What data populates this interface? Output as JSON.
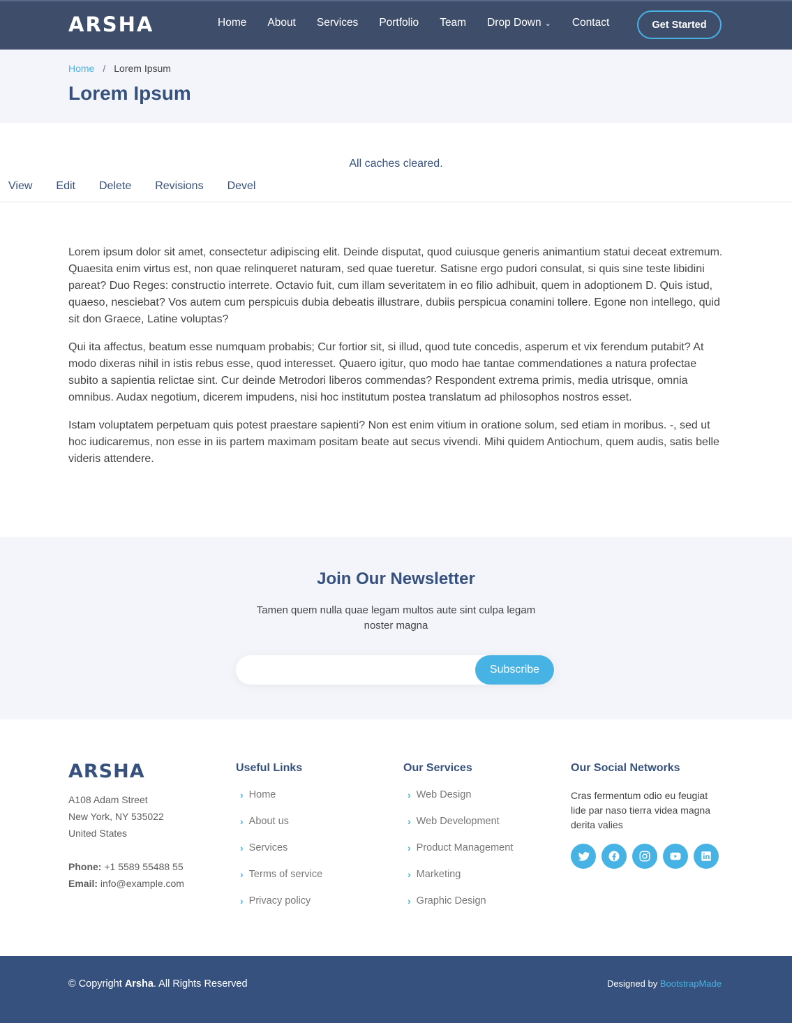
{
  "header": {
    "logo": "ARSHA",
    "nav": [
      "Home",
      "About",
      "Services",
      "Portfolio",
      "Team",
      "Drop Down",
      "Contact"
    ],
    "cta": "Get Started"
  },
  "breadcrumbs": {
    "home": "Home",
    "separator": "/",
    "current": "Lorem Ipsum",
    "title": "Lorem Ipsum"
  },
  "status_message": "All caches cleared.",
  "tabs": [
    "View",
    "Edit",
    "Delete",
    "Revisions",
    "Devel"
  ],
  "content": {
    "paragraphs": [
      "Lorem ipsum dolor sit amet, consectetur adipiscing elit. Deinde disputat, quod cuiusque generis animantium statui deceat extremum. Quaesita enim virtus est, non quae relinqueret naturam, sed quae tueretur. Satisne ergo pudori consulat, si quis sine teste libidini pareat? Duo Reges: constructio interrete. Octavio fuit, cum illam severitatem in eo filio adhibuit, quem in adoptionem D. Quis istud, quaeso, nesciebat? Vos autem cum perspicuis dubia debeatis illustrare, dubiis perspicua conamini tollere. Egone non intellego, quid sit don Graece, Latine voluptas?",
      "Qui ita affectus, beatum esse numquam probabis; Cur fortior sit, si illud, quod tute concedis, asperum et vix ferendum putabit? At modo dixeras nihil in istis rebus esse, quod interesset. Quaero igitur, quo modo hae tantae commendationes a natura profectae subito a sapientia relictae sint. Cur deinde Metrodori liberos commendas? Respondent extrema primis, media utrisque, omnia omnibus. Audax negotium, dicerem impudens, nisi hoc institutum postea translatum ad philosophos nostros esset.",
      "Istam voluptatem perpetuam quis potest praestare sapienti? Non est enim vitium in oratione solum, sed etiam in moribus. -, sed ut hoc iudicaremus, non esse in iis partem maximam positam beate aut secus vivendi. Mihi quidem Antiochum, quem audis, satis belle videris attendere."
    ]
  },
  "newsletter": {
    "title": "Join Our Newsletter",
    "text": "Tamen quem nulla quae legam multos aute sint culpa legam noster magna",
    "input_value": "",
    "button": "Subscribe"
  },
  "footer": {
    "logo": "ARSHA",
    "address": [
      "A108 Adam Street",
      "New York, NY 535022",
      "United States"
    ],
    "phone_label": "Phone:",
    "phone": "+1 5589 55488 55",
    "email_label": "Email:",
    "email": "info@example.com",
    "useful_links_title": "Useful Links",
    "useful_links": [
      "Home",
      "About us",
      "Services",
      "Terms of service",
      "Privacy policy"
    ],
    "services_title": "Our Services",
    "services": [
      "Web Design",
      "Web Development",
      "Product Management",
      "Marketing",
      "Graphic Design"
    ],
    "social_title": "Our Social Networks",
    "social_text": "Cras fermentum odio eu feugiat lide par naso tierra videa magna derita valies",
    "social_icons": [
      "twitter-icon",
      "facebook-icon",
      "instagram-icon",
      "youtube-icon",
      "linkedin-icon"
    ],
    "copyright_prefix": "© Copyright ",
    "copyright_brand": "Arsha",
    "copyright_suffix": ". All Rights Reserved",
    "credits_prefix": "Designed by ",
    "credits_link": "BootstrapMade"
  },
  "colors": {
    "header_bg": "#3d4d6a",
    "primary": "#37517e",
    "accent": "#47b2e4",
    "light_bg": "#f3f5fa"
  }
}
